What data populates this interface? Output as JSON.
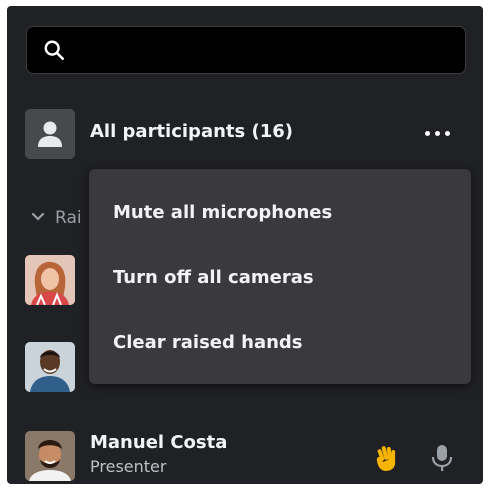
{
  "search": {
    "placeholder": "",
    "value": ""
  },
  "all_participants": {
    "label": "All participants (16)",
    "more_icon": "more-horizontal-icon"
  },
  "raised_section": {
    "label_visible": "Rai"
  },
  "menu": {
    "items": [
      {
        "label": "Mute all microphones"
      },
      {
        "label": "Turn off all cameras"
      },
      {
        "label": "Clear raised hands"
      }
    ]
  },
  "presenter": {
    "name": "Manuel Costa",
    "role": "Presenter"
  },
  "colors": {
    "panel_bg": "#202124",
    "menu_bg": "#3a3a3d",
    "hand": "#f5b400",
    "text": "#f1f3f4"
  }
}
